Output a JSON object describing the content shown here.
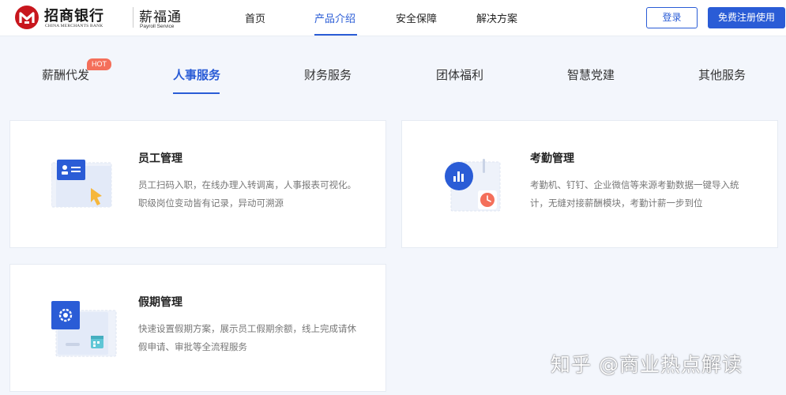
{
  "header": {
    "logo_cn": "招商银行",
    "logo_en": "CHINA MERCHANTS BANK",
    "product_cn": "薪福通",
    "product_en": "Payroll Service",
    "nav": [
      "首页",
      "产品介绍",
      "安全保障",
      "解决方案"
    ],
    "active_nav": "产品介绍",
    "login_label": "登录",
    "register_label": "免费注册使用"
  },
  "tabs": {
    "items": [
      "薪酬代发",
      "人事服务",
      "财务服务",
      "团体福利",
      "智慧党建",
      "其他服务"
    ],
    "active": "人事服务",
    "hot_badge": "HOT"
  },
  "cards": [
    {
      "title": "员工管理",
      "desc": "员工扫码入职，在线办理入转调离，人事报表可视化。职级岗位变动皆有记录，异动可溯源",
      "icon": "id-card-cursor-icon"
    },
    {
      "title": "考勤管理",
      "desc": "考勤机、钉钉、企业微信等来源考勤数据一键导入统计，无缝对接薪酬模块，考勤计薪一步到位",
      "icon": "attendance-chart-clock-icon"
    },
    {
      "title": "假期管理",
      "desc": "快速设置假期方案，展示员工假期余额，线上完成请休假申请、审批等全流程服务",
      "icon": "settings-calendar-icon"
    }
  ],
  "watermark": "知乎 @商业热点解读",
  "colors": {
    "primary": "#2a5cd6",
    "hot": "#f46f5a",
    "logo_red": "#c8161d",
    "background": "#f3f6fc"
  }
}
